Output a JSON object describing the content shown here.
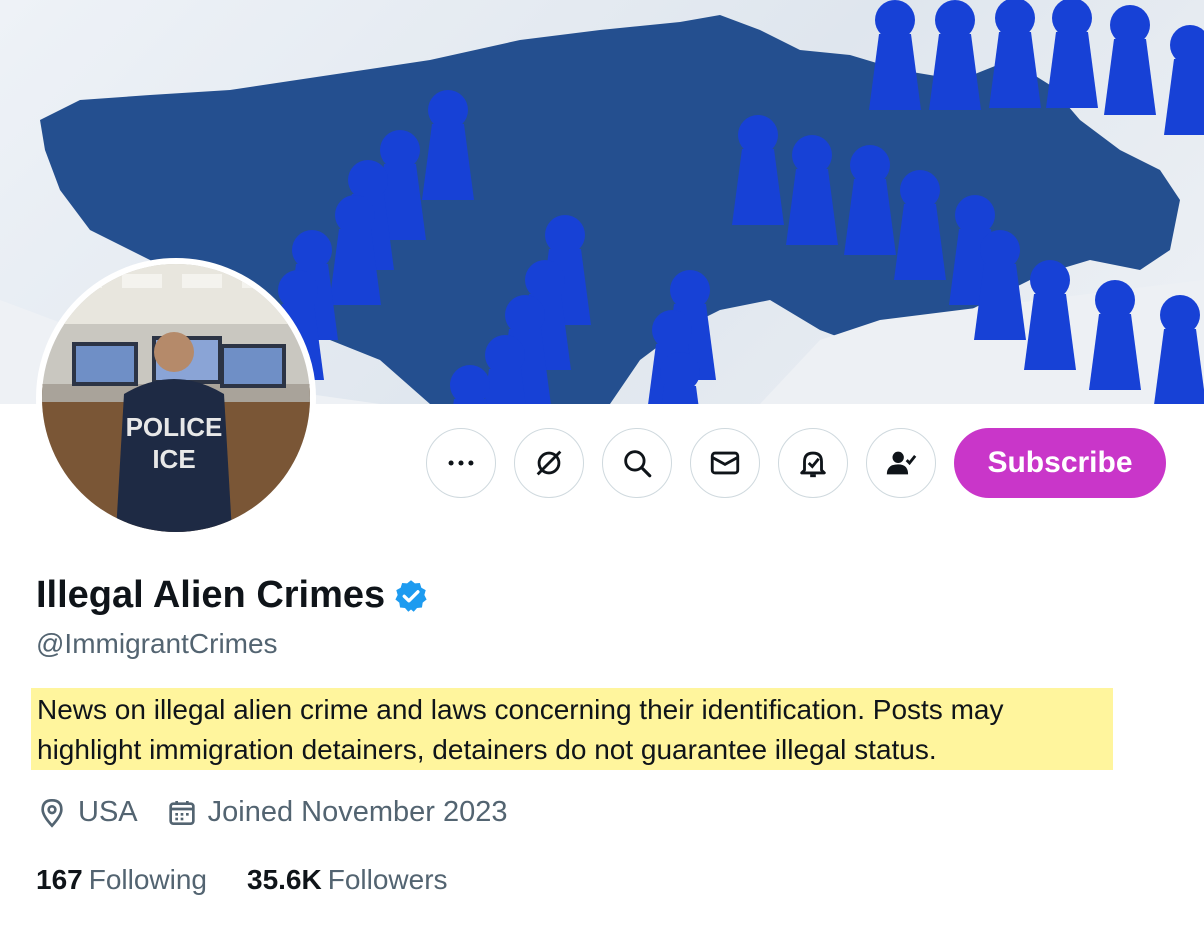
{
  "profile": {
    "display_name": "Illegal Alien Crimes",
    "handle": "@ImmigrantCrimes",
    "bio": "News on illegal alien crime and laws concerning their identification. Posts may highlight immigration detainers, detainers do not guarantee illegal status.",
    "location": "USA",
    "joined": "Joined November 2023",
    "verified": true
  },
  "stats": {
    "following_count": "167",
    "following_label": "Following",
    "followers_count": "35.6K",
    "followers_label": "Followers"
  },
  "actions": {
    "subscribe_label": "Subscribe",
    "icons": [
      "more-icon",
      "grok-icon",
      "search-icon",
      "message-icon",
      "notification-bell-icon",
      "following-person-icon"
    ]
  },
  "avatar": {
    "jacket_line1": "POLICE",
    "jacket_line2": "ICE"
  },
  "colors": {
    "subscribe_bg": "#c936c9",
    "verified_blue": "#1d9bf0",
    "bio_highlight": "#fff59d",
    "secondary_text": "#536471"
  }
}
